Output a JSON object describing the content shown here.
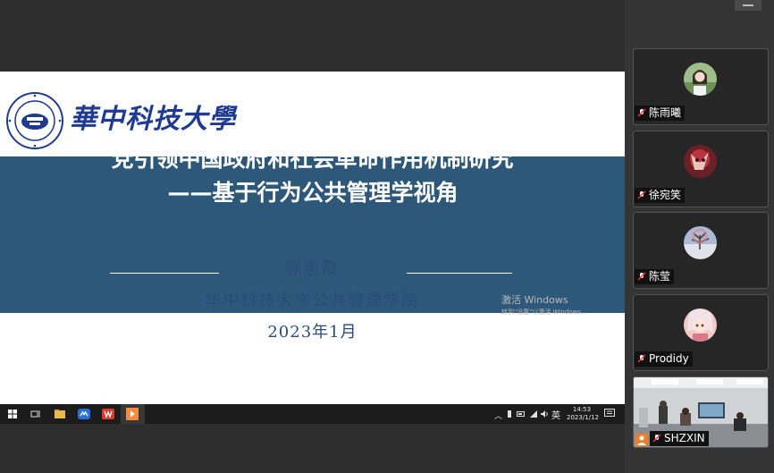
{
  "slide": {
    "university_name": "華中科技大學",
    "title": "党引领中国政府和社会革命作用机制研究",
    "subtitle": "——基于行为公共管理学视角",
    "author": "陈志霞",
    "school": "华中科技大学公共管理学院",
    "date": "2023年1月"
  },
  "watermark": {
    "line1": "激活 Windows",
    "line2": "转到\"设置\"以激活 Windows。"
  },
  "taskbar": {
    "language": "英",
    "time": "14:53",
    "date": "2023/1/12"
  },
  "participants": [
    {
      "name": "陈雨曦",
      "avatar": "portrait-photo",
      "muted": true
    },
    {
      "name": "徐宛笑",
      "avatar": "anime-red-avatar",
      "muted": true
    },
    {
      "name": "陈莹",
      "avatar": "winter-tree-photo",
      "muted": true
    },
    {
      "name": "Prodidy",
      "avatar": "anime-pink-avatar",
      "muted": true
    },
    {
      "name": "SHZXIN",
      "avatar": "meeting-room-video",
      "muted": true
    }
  ],
  "colors": {
    "band": "#2e5879",
    "text_blue": "#2a4b7c",
    "logo_blue": "#1f3a93"
  }
}
